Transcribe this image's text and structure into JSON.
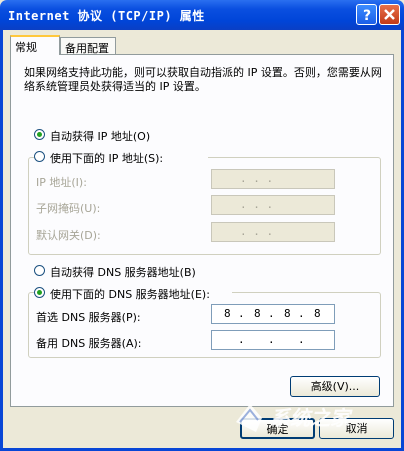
{
  "window": {
    "title": "Internet 协议 (TCP/IP) 属性",
    "help_glyph": "?",
    "close_glyph": "✕"
  },
  "tabs": [
    {
      "label": "常规",
      "active": true
    },
    {
      "label": "备用配置",
      "active": false
    }
  ],
  "description": "如果网络支持此功能，则可以获取自动指派的 IP 设置。否则，您需要从网络系统管理员处获得适当的 IP 设置。",
  "ip_section": {
    "auto_label": "自动获得 IP 地址(O)",
    "manual_label": "使用下面的 IP 地址(S):",
    "selected": "auto",
    "fields": [
      {
        "label": "IP 地址(I):",
        "value": ". . ."
      },
      {
        "label": "子网掩码(U):",
        "value": ". . ."
      },
      {
        "label": "默认网关(D):",
        "value": ". . ."
      }
    ]
  },
  "dns_section": {
    "auto_label": "自动获得 DNS 服务器地址(B)",
    "manual_label": "使用下面的 DNS 服务器地址(E):",
    "selected": "manual",
    "fields": [
      {
        "label": "首选 DNS 服务器(P):",
        "octets": [
          "8",
          "8",
          "8",
          "8"
        ]
      },
      {
        "label": "备用 DNS 服务器(A):",
        "octets": [
          "",
          "",
          "",
          ""
        ]
      }
    ]
  },
  "buttons": {
    "advanced": "高级(V)...",
    "ok": "确定",
    "cancel": "取消"
  },
  "watermark": {
    "text": "系统之家"
  },
  "colors": {
    "titlebar": "#0a4fe0",
    "dialog_bg": "#ece9d8",
    "panel_bg": "#fcfcfe",
    "radio_checked": "#21a121",
    "tab_highlight": "#ffc83c"
  }
}
